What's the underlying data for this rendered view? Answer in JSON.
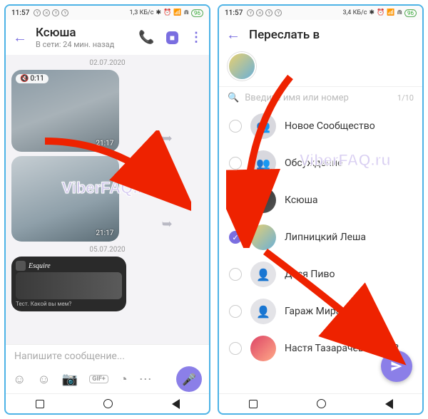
{
  "left": {
    "status": {
      "time": "11:57",
      "net": "1,3 КБ/с",
      "battery": "96"
    },
    "header": {
      "title": "Ксюша",
      "subtitle": "В сети: 24 мин. назад"
    },
    "dates": {
      "d1": "02.07.2020",
      "d2": "05.07.2020"
    },
    "video1": {
      "duration": "0:11",
      "time": "21:17"
    },
    "video2": {
      "time": "21:17"
    },
    "esquire": {
      "name": "Esquire",
      "caption": "Тест. Какой вы мем?"
    },
    "compose": {
      "placeholder": "Напишите сообщение..."
    },
    "gif_label": "GIF+"
  },
  "right": {
    "status": {
      "time": "11:57",
      "net": "3,4 КБ/с",
      "battery": "96"
    },
    "header": {
      "title": "Переслать в"
    },
    "search": {
      "placeholder": "Введите имя или номер",
      "count": "1/10"
    },
    "contacts": [
      {
        "name": "Новое Сообщество"
      },
      {
        "name": "Обсуждение"
      },
      {
        "name": "Ксюша"
      },
      {
        "name": "Липницкий Леша"
      },
      {
        "name": "Деся Пиво"
      },
      {
        "name": "Гараж Мира"
      },
      {
        "name": "Настя Тазарачева Теле2"
      }
    ]
  },
  "watermark": "ViberFAQ.ru"
}
